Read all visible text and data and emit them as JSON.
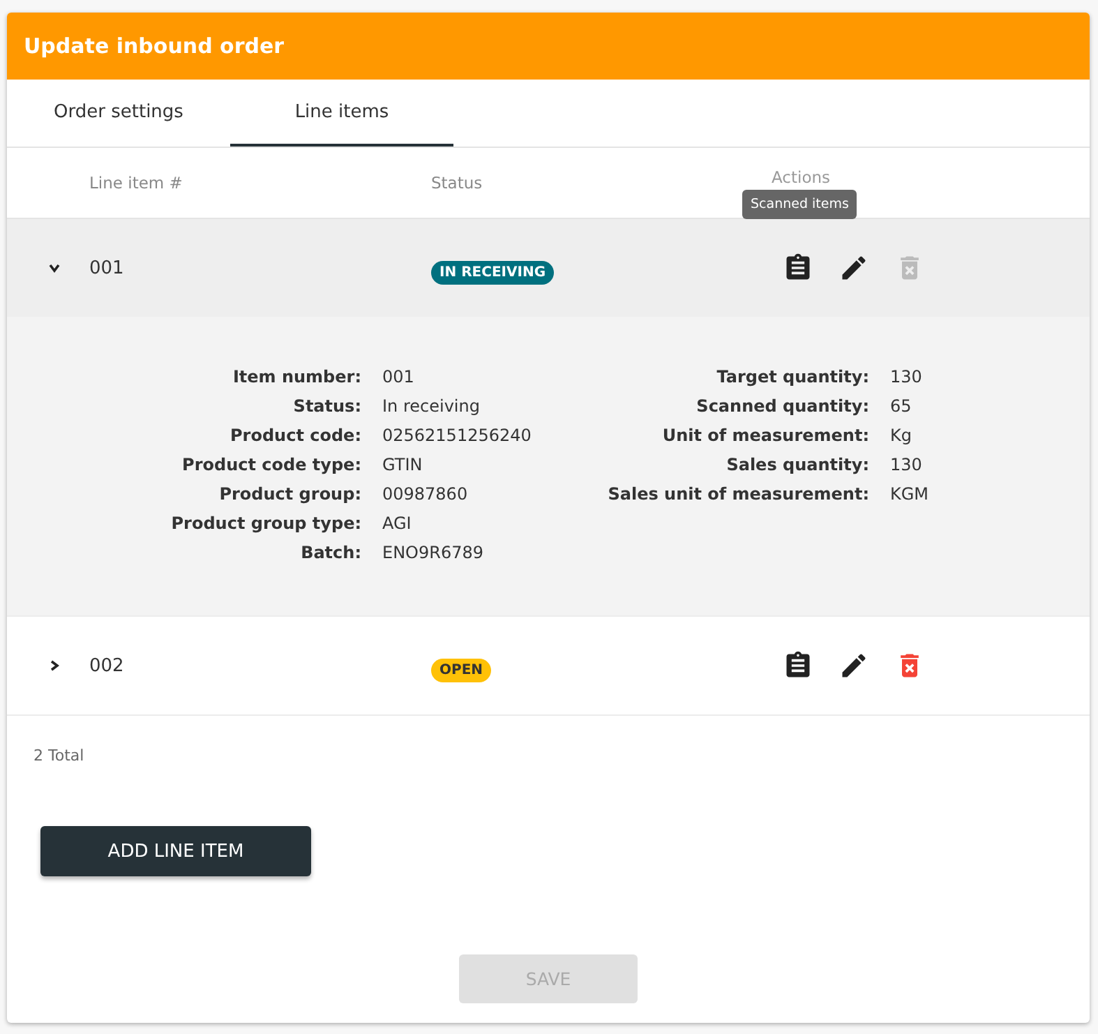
{
  "dialog": {
    "title": "Update inbound order"
  },
  "tabs": [
    {
      "label": "Order settings",
      "selected": false
    },
    {
      "label": "Line items",
      "selected": true
    }
  ],
  "table": {
    "columns": [
      "Line item #",
      "Status",
      "Actions"
    ],
    "rows": [
      {
        "line_item": "001",
        "status": "IN RECEIVING",
        "kind": "receiving",
        "expanded": true,
        "delete_disabled": true,
        "details_left": [
          {
            "label": "Item number:",
            "value": "001"
          },
          {
            "label": "Status:",
            "value": "In receiving"
          },
          {
            "label": "Product code:",
            "value": "02562151256240"
          },
          {
            "label": "Product code type:",
            "value": "GTIN"
          },
          {
            "label": "Product group:",
            "value": "00987860"
          },
          {
            "label": "Product group type:",
            "value": "AGI"
          },
          {
            "label": "Batch:",
            "value": "ENO9R6789"
          }
        ],
        "details_right": [
          {
            "label": "Target quantity:",
            "value": "130"
          },
          {
            "label": "Scanned quantity:",
            "value": "65"
          },
          {
            "label": "Unit of measurement:",
            "value": "Kg"
          },
          {
            "label": "Sales quantity:",
            "value": "130"
          },
          {
            "label": "Sales unit of measurement:",
            "value": "KGM"
          }
        ]
      },
      {
        "line_item": "002",
        "status": "OPEN",
        "kind": "open",
        "expanded": false,
        "delete_disabled": false
      }
    ]
  },
  "tooltip": {
    "text": "Scanned items"
  },
  "total": "2 Total",
  "buttons": {
    "add": "ADD LINE ITEM",
    "save": {
      "label": "SAVE",
      "disabled": true
    }
  }
}
